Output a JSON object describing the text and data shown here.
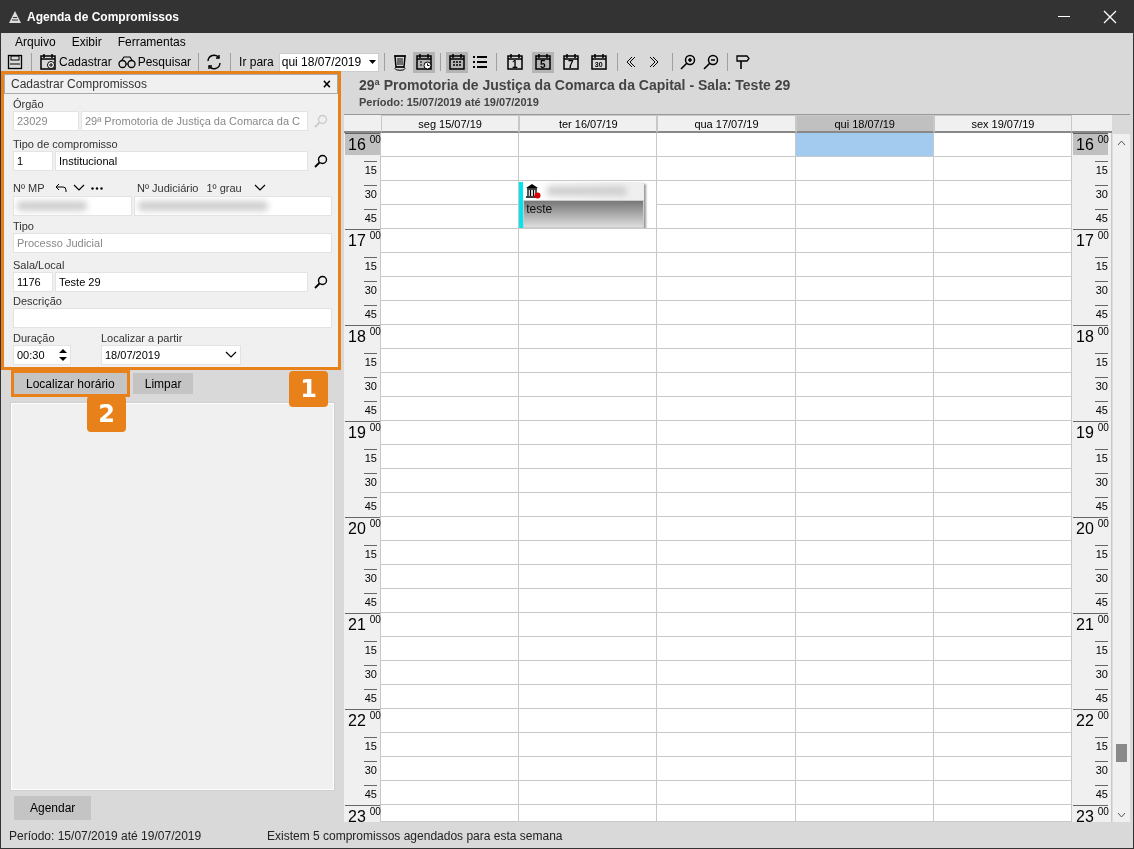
{
  "window": {
    "title": "Agenda de Compromissos"
  },
  "menu": [
    "Arquivo",
    "Exibir",
    "Ferramentas"
  ],
  "toolbar": [
    [
      {
        "kind": "save",
        "pressed": false
      }
    ],
    [
      {
        "kind": "new",
        "label": "Cadastrar",
        "pressed": false
      },
      {
        "kind": "search",
        "label": "Pesquisar",
        "pressed": false
      }
    ],
    [
      {
        "kind": "refresh",
        "pressed": false
      }
    ],
    [
      {
        "kind": "goto",
        "label": "Ir para",
        "value": "qui 18/07/2019"
      }
    ],
    [
      {
        "kind": "trash",
        "pressed": false
      },
      {
        "kind": "calendar-clock",
        "pressed": true
      }
    ],
    [
      {
        "kind": "calendar-grid",
        "pressed": true
      },
      {
        "kind": "list",
        "pressed": false
      }
    ],
    [
      {
        "kind": "day-view",
        "label": "1",
        "pressed": false
      },
      {
        "kind": "day-view",
        "label": "5",
        "pressed": true
      },
      {
        "kind": "day-view",
        "label": "7",
        "pressed": false
      },
      {
        "kind": "day-view",
        "label": "30",
        "pressed": false
      }
    ],
    [
      {
        "kind": "prev",
        "pressed": false
      },
      {
        "kind": "next",
        "pressed": false
      }
    ],
    [
      {
        "kind": "zoom-in",
        "pressed": false
      },
      {
        "kind": "zoom-out",
        "pressed": false
      }
    ],
    [
      {
        "kind": "signpost",
        "pressed": false
      }
    ]
  ],
  "form": {
    "title": "Cadastrar Compromissos",
    "close": "×",
    "highlighted": true,
    "orgao": {
      "label": "Órgão",
      "code": "23029",
      "name": "29ª Promotoria de Justiça da Comarca da C",
      "disabled": true
    },
    "tipo_compromisso": {
      "label": "Tipo de compromisso",
      "code": "1",
      "name": "Institucional",
      "disabled": false
    },
    "numeros": {
      "mp_label": "Nº MP",
      "jud_label": "Nº Judiciário",
      "grau": "1º grau"
    },
    "tipo": {
      "label": "Tipo",
      "value": "Processo Judicial",
      "disabled": true
    },
    "sala": {
      "label": "Sala/Local",
      "code": "1176",
      "name": "Teste 29",
      "disabled": false
    },
    "descricao": {
      "label": "Descrição"
    },
    "duracao": {
      "label": "Duração",
      "value": "00:30"
    },
    "localizar": {
      "label": "Localizar a partir",
      "value": "18/07/2019"
    }
  },
  "actions": [
    {
      "label": "Localizar horário",
      "highlighted": true
    },
    {
      "label": "Limpar",
      "highlighted": false
    }
  ],
  "schedule_button": "Agendar",
  "callouts": [
    {
      "label": "1"
    },
    {
      "label": "2"
    }
  ],
  "calendar": {
    "title": "29ª Promotoria de Justiça da Comarca da Capital - Sala: Teste 29",
    "period": "Período: 15/07/2019 até 19/07/2019",
    "days": [
      {
        "label": "seg 15/07/19",
        "selected": false
      },
      {
        "label": "ter 16/07/19",
        "selected": false
      },
      {
        "label": "qua 17/07/19",
        "selected": false
      },
      {
        "label": "qui 18/07/19",
        "selected": true
      },
      {
        "label": "sex 19/07/19",
        "selected": false
      }
    ],
    "rows": [
      {
        "kind": "hour",
        "left": {
          "label": "16",
          "minutes": "00",
          "selected": true
        },
        "right": {
          "label": "16",
          "minutes": "00",
          "selected": true
        },
        "cells": [
          {
            "selected": false
          },
          {
            "selected": false
          },
          {
            "selected": false
          },
          {
            "selected": true
          },
          {
            "selected": false
          }
        ]
      },
      {
        "kind": "quarter",
        "left": {
          "label": "15"
        },
        "right": {
          "label": "15"
        },
        "cells": [
          {
            "selected": false
          },
          {
            "selected": false
          },
          {
            "selected": false
          },
          {
            "selected": false
          },
          {
            "selected": false
          }
        ]
      },
      {
        "kind": "quarter",
        "left": {
          "label": "30"
        },
        "right": {
          "label": "30"
        },
        "cells": [
          {
            "selected": false
          },
          {
            "selected": false,
            "event": {
              "text": "teste"
            }
          },
          {
            "selected": false
          },
          {
            "selected": false
          },
          {
            "selected": false
          }
        ]
      },
      {
        "kind": "quarter",
        "left": {
          "label": "45"
        },
        "right": {
          "label": "45"
        },
        "cells": [
          {
            "selected": false
          },
          {
            "selected": false
          },
          {
            "selected": false
          },
          {
            "selected": false
          }
        ]
      },
      {
        "kind": "hour",
        "left": {
          "label": "17",
          "minutes": "00",
          "selected": false
        },
        "right": {
          "label": "17",
          "minutes": "00",
          "selected": false
        },
        "cells": [
          {
            "selected": false
          },
          {
            "selected": false
          },
          {
            "selected": false
          },
          {
            "selected": false
          },
          {
            "selected": false
          }
        ]
      },
      {
        "kind": "quarter",
        "left": {
          "label": "15"
        },
        "right": {
          "label": "15"
        },
        "cells": [
          {
            "selected": false
          },
          {
            "selected": false
          },
          {
            "selected": false
          },
          {
            "selected": false
          },
          {
            "selected": false
          }
        ]
      },
      {
        "kind": "quarter",
        "left": {
          "label": "30"
        },
        "right": {
          "label": "30"
        },
        "cells": [
          {
            "selected": false
          },
          {
            "selected": false
          },
          {
            "selected": false
          },
          {
            "selected": false
          },
          {
            "selected": false
          }
        ]
      },
      {
        "kind": "quarter",
        "left": {
          "label": "45"
        },
        "right": {
          "label": "45"
        },
        "cells": [
          {
            "selected": false
          },
          {
            "selected": false
          },
          {
            "selected": false
          },
          {
            "selected": false
          },
          {
            "selected": false
          }
        ]
      },
      {
        "kind": "hour",
        "left": {
          "label": "18",
          "minutes": "00",
          "selected": false
        },
        "right": {
          "label": "18",
          "minutes": "00",
          "selected": false
        },
        "cells": [
          {
            "selected": false
          },
          {
            "selected": false
          },
          {
            "selected": false
          },
          {
            "selected": false
          },
          {
            "selected": false
          }
        ]
      },
      {
        "kind": "quarter",
        "left": {
          "label": "15"
        },
        "right": {
          "label": "15"
        },
        "cells": [
          {
            "selected": false
          },
          {
            "selected": false
          },
          {
            "selected": false
          },
          {
            "selected": false
          },
          {
            "selected": false
          }
        ]
      },
      {
        "kind": "quarter",
        "left": {
          "label": "30"
        },
        "right": {
          "label": "30"
        },
        "cells": [
          {
            "selected": false
          },
          {
            "selected": false
          },
          {
            "selected": false
          },
          {
            "selected": false
          },
          {
            "selected": false
          }
        ]
      },
      {
        "kind": "quarter",
        "left": {
          "label": "45"
        },
        "right": {
          "label": "45"
        },
        "cells": [
          {
            "selected": false
          },
          {
            "selected": false
          },
          {
            "selected": false
          },
          {
            "selected": false
          },
          {
            "selected": false
          }
        ]
      },
      {
        "kind": "hour",
        "left": {
          "label": "19",
          "minutes": "00",
          "selected": false
        },
        "right": {
          "label": "19",
          "minutes": "00",
          "selected": false
        },
        "cells": [
          {
            "selected": false
          },
          {
            "selected": false
          },
          {
            "selected": false
          },
          {
            "selected": false
          },
          {
            "selected": false
          }
        ]
      },
      {
        "kind": "quarter",
        "left": {
          "label": "15"
        },
        "right": {
          "label": "15"
        },
        "cells": [
          {
            "selected": false
          },
          {
            "selected": false
          },
          {
            "selected": false
          },
          {
            "selected": false
          },
          {
            "selected": false
          }
        ]
      },
      {
        "kind": "quarter",
        "left": {
          "label": "30"
        },
        "right": {
          "label": "30"
        },
        "cells": [
          {
            "selected": false
          },
          {
            "selected": false
          },
          {
            "selected": false
          },
          {
            "selected": false
          },
          {
            "selected": false
          }
        ]
      },
      {
        "kind": "quarter",
        "left": {
          "label": "45"
        },
        "right": {
          "label": "45"
        },
        "cells": [
          {
            "selected": false
          },
          {
            "selected": false
          },
          {
            "selected": false
          },
          {
            "selected": false
          },
          {
            "selected": false
          }
        ]
      },
      {
        "kind": "hour",
        "left": {
          "label": "20",
          "minutes": "00",
          "selected": false
        },
        "right": {
          "label": "20",
          "minutes": "00",
          "selected": false
        },
        "cells": [
          {
            "selected": false
          },
          {
            "selected": false
          },
          {
            "selected": false
          },
          {
            "selected": false
          },
          {
            "selected": false
          }
        ]
      },
      {
        "kind": "quarter",
        "left": {
          "label": "15"
        },
        "right": {
          "label": "15"
        },
        "cells": [
          {
            "selected": false
          },
          {
            "selected": false
          },
          {
            "selected": false
          },
          {
            "selected": false
          },
          {
            "selected": false
          }
        ]
      },
      {
        "kind": "quarter",
        "left": {
          "label": "30"
        },
        "right": {
          "label": "30"
        },
        "cells": [
          {
            "selected": false
          },
          {
            "selected": false
          },
          {
            "selected": false
          },
          {
            "selected": false
          },
          {
            "selected": false
          }
        ]
      },
      {
        "kind": "quarter",
        "left": {
          "label": "45"
        },
        "right": {
          "label": "45"
        },
        "cells": [
          {
            "selected": false
          },
          {
            "selected": false
          },
          {
            "selected": false
          },
          {
            "selected": false
          },
          {
            "selected": false
          }
        ]
      },
      {
        "kind": "hour",
        "left": {
          "label": "21",
          "minutes": "00",
          "selected": false
        },
        "right": {
          "label": "21",
          "minutes": "00",
          "selected": false
        },
        "cells": [
          {
            "selected": false
          },
          {
            "selected": false
          },
          {
            "selected": false
          },
          {
            "selected": false
          },
          {
            "selected": false
          }
        ]
      },
      {
        "kind": "quarter",
        "left": {
          "label": "15"
        },
        "right": {
          "label": "15"
        },
        "cells": [
          {
            "selected": false
          },
          {
            "selected": false
          },
          {
            "selected": false
          },
          {
            "selected": false
          },
          {
            "selected": false
          }
        ]
      },
      {
        "kind": "quarter",
        "left": {
          "label": "30"
        },
        "right": {
          "label": "30"
        },
        "cells": [
          {
            "selected": false
          },
          {
            "selected": false
          },
          {
            "selected": false
          },
          {
            "selected": false
          },
          {
            "selected": false
          }
        ]
      },
      {
        "kind": "quarter",
        "left": {
          "label": "45"
        },
        "right": {
          "label": "45"
        },
        "cells": [
          {
            "selected": false
          },
          {
            "selected": false
          },
          {
            "selected": false
          },
          {
            "selected": false
          },
          {
            "selected": false
          }
        ]
      },
      {
        "kind": "hour",
        "left": {
          "label": "22",
          "minutes": "00",
          "selected": false
        },
        "right": {
          "label": "22",
          "minutes": "00",
          "selected": false
        },
        "cells": [
          {
            "selected": false
          },
          {
            "selected": false
          },
          {
            "selected": false
          },
          {
            "selected": false
          },
          {
            "selected": false
          }
        ]
      },
      {
        "kind": "quarter",
        "left": {
          "label": "15"
        },
        "right": {
          "label": "15"
        },
        "cells": [
          {
            "selected": false
          },
          {
            "selected": false
          },
          {
            "selected": false
          },
          {
            "selected": false
          },
          {
            "selected": false
          }
        ]
      },
      {
        "kind": "quarter",
        "left": {
          "label": "30"
        },
        "right": {
          "label": "30"
        },
        "cells": [
          {
            "selected": false
          },
          {
            "selected": false
          },
          {
            "selected": false
          },
          {
            "selected": false
          },
          {
            "selected": false
          }
        ]
      },
      {
        "kind": "quarter",
        "left": {
          "label": "45"
        },
        "right": {
          "label": "45"
        },
        "cells": [
          {
            "selected": false
          },
          {
            "selected": false
          },
          {
            "selected": false
          },
          {
            "selected": false
          },
          {
            "selected": false
          }
        ]
      },
      {
        "kind": "hour",
        "left": {
          "label": "23",
          "minutes": "00",
          "selected": false
        },
        "right": {
          "label": "23",
          "minutes": "00",
          "selected": false
        },
        "cells": [
          {
            "selected": false
          },
          {
            "selected": false
          },
          {
            "selected": false
          },
          {
            "selected": false
          },
          {
            "selected": false
          }
        ]
      }
    ]
  },
  "status_bar": [
    "Período: 15/07/2019 até 19/07/2019",
    "Existem 5 compromissos agendados para esta semana"
  ]
}
